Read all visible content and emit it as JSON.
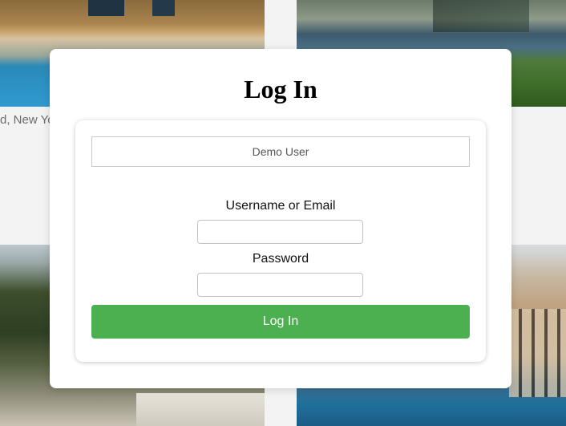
{
  "background": {
    "listing_caption": "d, New Yo"
  },
  "modal": {
    "title": "Log In",
    "demo_button_label": "Demo User",
    "username_label": "Username or Email",
    "username_value": "",
    "password_label": "Password",
    "password_value": "",
    "submit_label": "Log In",
    "accent_color": "#4caf50"
  }
}
